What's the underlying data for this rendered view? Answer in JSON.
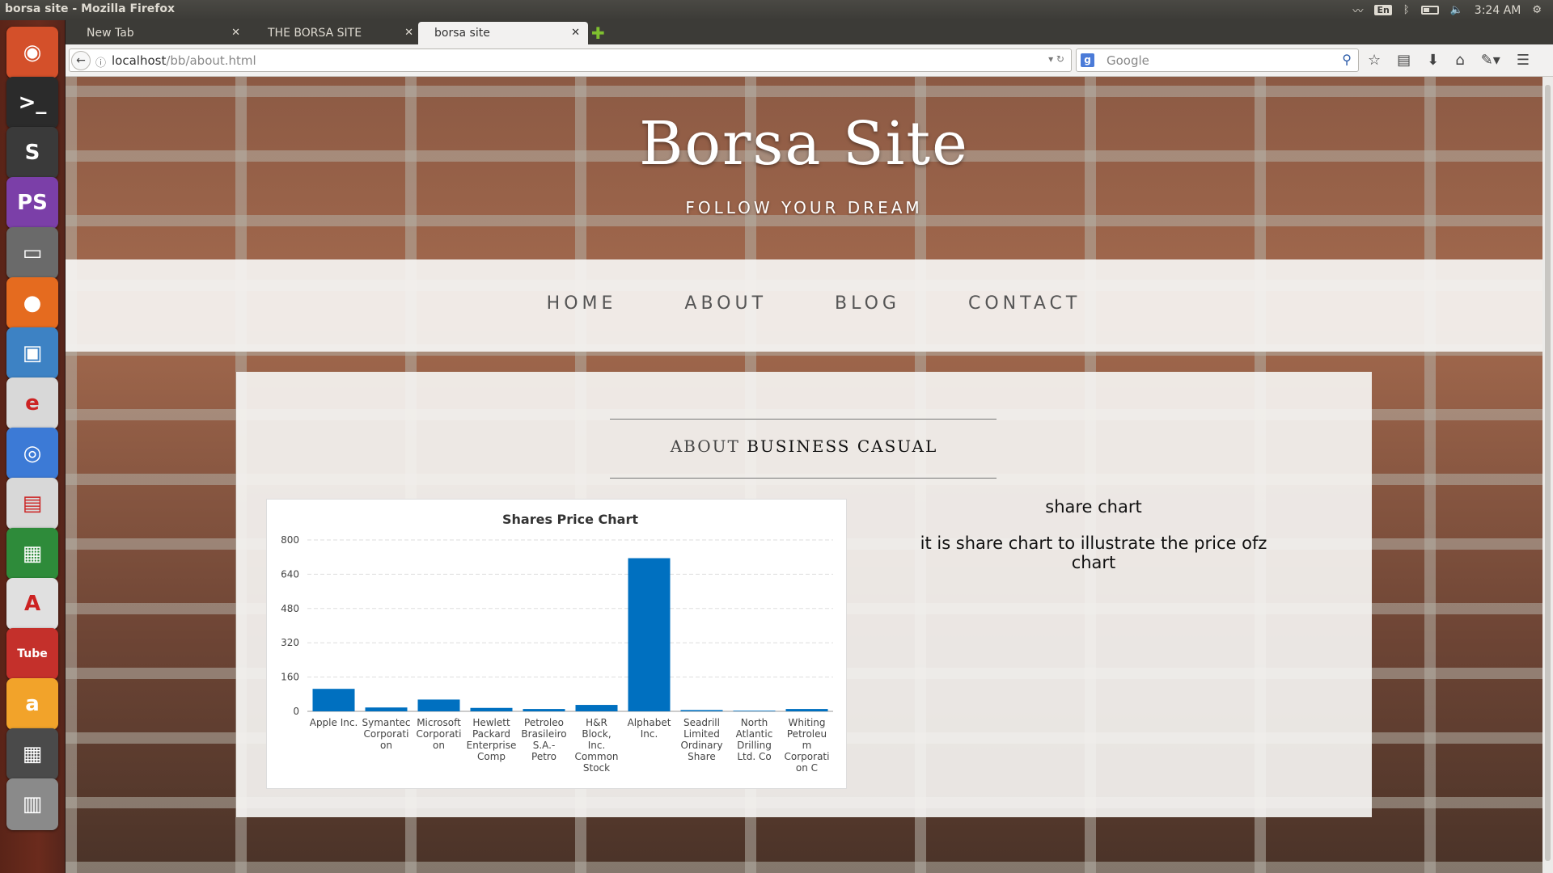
{
  "window": {
    "title": "borsa site - Mozilla Firefox",
    "time": "3:24 AM",
    "lang": "En"
  },
  "tabs": [
    {
      "label": "New Tab"
    },
    {
      "label": "THE BORSA SITE"
    },
    {
      "label": "borsa site"
    }
  ],
  "urlbar": {
    "host": "localhost",
    "path": "/bb/about.html"
  },
  "search": {
    "placeholder": "Google",
    "engine_letter": "g"
  },
  "site": {
    "brand": "Borsa Site",
    "tagline": "FOLLOW YOUR DREAM",
    "nav": [
      "HOME",
      "ABOUT",
      "BLOG",
      "CONTACT"
    ],
    "section_title_light": "ABOUT",
    "section_title_bold": "BUSINESS CASUAL",
    "side_heading": "share chart",
    "side_text": "it is share chart to illustrate the price ofz chart"
  },
  "launcher": [
    {
      "name": "ubuntu-dash-icon",
      "glyph": "◉",
      "bg": "#d4502a"
    },
    {
      "name": "terminal-icon",
      "glyph": ">_",
      "bg": "#2b2b2b"
    },
    {
      "name": "sublime-text-icon",
      "glyph": "S",
      "bg": "#3a3a3a"
    },
    {
      "name": "phpstorm-icon",
      "glyph": "PS",
      "bg": "#7b3fa8"
    },
    {
      "name": "files-icon",
      "glyph": "▭",
      "bg": "#6a6a6a"
    },
    {
      "name": "firefox-icon",
      "glyph": "●",
      "bg": "#e56b1f"
    },
    {
      "name": "virtualbox-icon",
      "glyph": "▣",
      "bg": "#3d82c4"
    },
    {
      "name": "emacs-icon",
      "glyph": "e",
      "bg": "#d8d8d8"
    },
    {
      "name": "chromium-icon",
      "glyph": "◎",
      "bg": "#3c7ad6"
    },
    {
      "name": "libreoffice-impress-icon",
      "glyph": "▤",
      "bg": "#d8d8d8"
    },
    {
      "name": "libreoffice-calc-icon",
      "glyph": "▦",
      "bg": "#2e8b3a"
    },
    {
      "name": "ubuntu-software-icon",
      "glyph": "A",
      "bg": "#e0e0e0"
    },
    {
      "name": "youtube-icon",
      "glyph": "Tube",
      "bg": "#c4302b"
    },
    {
      "name": "amazon-icon",
      "glyph": "a",
      "bg": "#f2a32a"
    },
    {
      "name": "workspace-switcher-icon",
      "glyph": "▦",
      "bg": "#4a4a4a"
    },
    {
      "name": "trash-icon",
      "glyph": "▥",
      "bg": "#8a8a8a"
    }
  ],
  "colors": {
    "bar": "#0070c0",
    "accent_green": "#7fbf2f"
  },
  "chart_data": {
    "type": "bar",
    "title": "Shares Price Chart",
    "categories": [
      [
        "Apple Inc."
      ],
      [
        "Symantec",
        "Corporati",
        "on"
      ],
      [
        "Microsoft",
        "Corporati",
        "on"
      ],
      [
        "Hewlett",
        "Packard",
        "Enterprise",
        "Comp"
      ],
      [
        "Petroleo",
        "Brasileiro",
        "S.A.-",
        "Petro"
      ],
      [
        "H&R",
        "Block,",
        "Inc.",
        "Common",
        "Stock"
      ],
      [
        "Alphabet",
        "Inc."
      ],
      [
        "Seadrill",
        "Limited",
        "Ordinary",
        "Share"
      ],
      [
        "North",
        "Atlantic",
        "Drilling",
        "Ltd. Co"
      ],
      [
        "Whiting",
        "Petroleu",
        "m",
        "Corporati",
        "on C"
      ]
    ],
    "values": [
      105,
      18,
      55,
      16,
      11,
      30,
      715,
      6,
      3,
      11
    ],
    "ylim": [
      0,
      800
    ],
    "yticks": [
      0,
      160,
      320,
      480,
      640,
      800
    ],
    "grid": true
  }
}
